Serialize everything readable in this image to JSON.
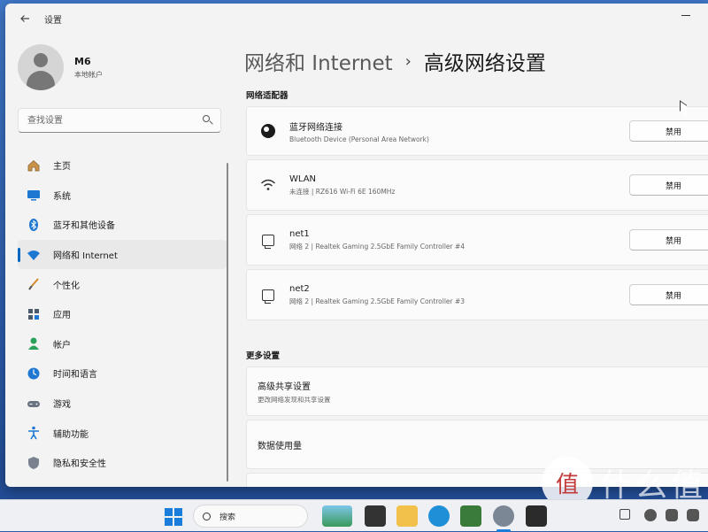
{
  "window": {
    "app_title": "设置"
  },
  "user": {
    "name": "M6",
    "account_type": "本地帐户"
  },
  "search": {
    "placeholder": "查找设置"
  },
  "sidebar": {
    "items": [
      {
        "label": "主页",
        "icon": "home-icon",
        "active": false
      },
      {
        "label": "系统",
        "icon": "system-icon",
        "active": false
      },
      {
        "label": "蓝牙和其他设备",
        "icon": "bluetooth-icon",
        "active": false
      },
      {
        "label": "网络和 Internet",
        "icon": "wifi-icon",
        "active": true
      },
      {
        "label": "个性化",
        "icon": "brush-icon",
        "active": false
      },
      {
        "label": "应用",
        "icon": "apps-icon",
        "active": false
      },
      {
        "label": "帐户",
        "icon": "account-icon",
        "active": false
      },
      {
        "label": "时间和语言",
        "icon": "globe-clock-icon",
        "active": false
      },
      {
        "label": "游戏",
        "icon": "gamepad-icon",
        "active": false
      },
      {
        "label": "辅助功能",
        "icon": "accessibility-icon",
        "active": false
      },
      {
        "label": "隐私和安全性",
        "icon": "shield-icon",
        "active": false
      }
    ]
  },
  "breadcrumb": {
    "parent": "网络和 Internet",
    "separator": "›",
    "current": "高级网络设置"
  },
  "adapters_section": {
    "title": "网络适配器",
    "adapters": [
      {
        "name": "蓝牙网络连接",
        "description": "Bluetooth Device (Personal Area Network)",
        "button": "禁用",
        "icon": "globe-network-icon"
      },
      {
        "name": "WLAN",
        "description": "未连接 | RZ616 Wi-Fi 6E 160MHz",
        "button": "禁用",
        "icon": "wifi-icon"
      },
      {
        "name": "net1",
        "description": "网络 2 | Realtek Gaming 2.5GbE Family Controller #4",
        "button": "禁用",
        "icon": "ethernet-icon"
      },
      {
        "name": "net2",
        "description": "网络 2 | Realtek Gaming 2.5GbE Family Controller #3",
        "button": "禁用",
        "icon": "ethernet-icon"
      }
    ]
  },
  "more_section": {
    "title": "更多设置",
    "items": [
      {
        "title": "高级共享设置",
        "subtitle": "更改网络发现和共享设置"
      },
      {
        "title": "数据使用量",
        "subtitle": ""
      }
    ]
  },
  "taskbar": {
    "search_label": "搜索"
  },
  "watermark": {
    "badge": "值",
    "text": "什么值"
  },
  "colors": {
    "accent": "#0067c0",
    "window_bg": "#f3f3f3",
    "card_bg": "#fbfbfb"
  }
}
